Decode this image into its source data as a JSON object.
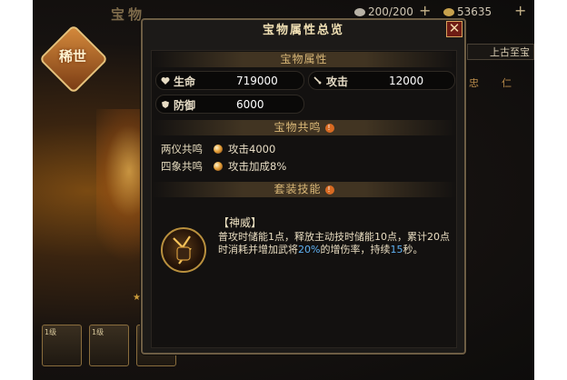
{
  "background": {
    "title": "宝物",
    "resources": [
      {
        "icon": "coin-icon",
        "value": "200/200"
      },
      {
        "icon": "treasure-icon",
        "value": "53635"
      }
    ],
    "rarity_badge": "稀世",
    "side_tag": "上古至宝",
    "side_tabs": [
      "忠",
      "仁"
    ],
    "slots": [
      {
        "level": "1级"
      },
      {
        "level": "1级"
      },
      {
        "level": ""
      }
    ]
  },
  "modal": {
    "title": "宝物属性总览",
    "sections": {
      "attributes": "宝物属性",
      "resonance": "宝物共鸣",
      "set_skill": "套装技能"
    },
    "attributes": [
      {
        "icon": "heart-icon",
        "name": "生命",
        "value": "719000"
      },
      {
        "icon": "sword-icon",
        "name": "攻击",
        "value": "12000"
      },
      {
        "icon": "shield-icon",
        "name": "防御",
        "value": "6000"
      }
    ],
    "resonance": [
      {
        "label": "两仪共鸣",
        "effect": "攻击4000"
      },
      {
        "label": "四象共鸣",
        "effect": "攻击加成8%"
      }
    ],
    "skill": {
      "name": "【神威】",
      "desc_part1": "普攻时储能1点，释放主动技时储能10点，累计20点时消耗并增加武将",
      "desc_highlight1": "20%",
      "desc_part2": "的增伤率，持续",
      "desc_highlight2": "15",
      "desc_part3": "秒。"
    }
  },
  "colors": {
    "accent_gold": "#d9b777",
    "highlight_blue": "#5fb1f2",
    "close_red": "#6e1c14"
  }
}
